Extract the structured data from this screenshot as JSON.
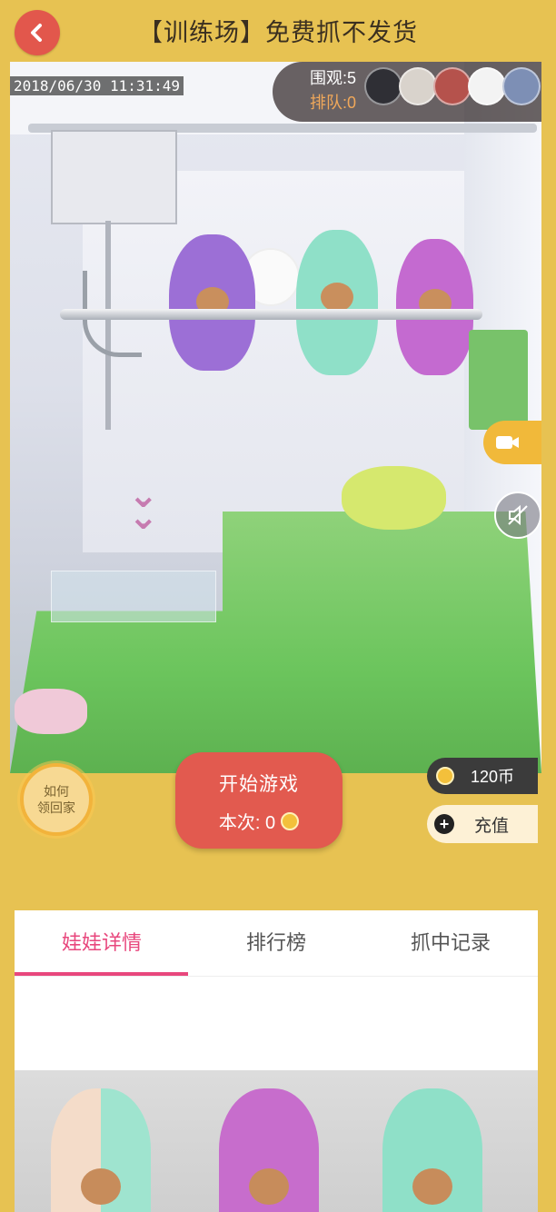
{
  "header": {
    "title": "【训练场】免费抓不发货"
  },
  "camera": {
    "timestamp": "2018/06/30 11:31:49",
    "watch_count": "围观:5",
    "queue_count": "排队:0"
  },
  "controls": {
    "howto_line1": "如何",
    "howto_line2": "领回家",
    "start_label": "开始游戏",
    "cost_label": "本次: 0",
    "balance": "120币",
    "recharge_label": "充值"
  },
  "tabs": [
    {
      "label": "娃娃详情",
      "active": true
    },
    {
      "label": "排行榜",
      "active": false
    },
    {
      "label": "抓中记录",
      "active": false
    }
  ],
  "colors": {
    "background": "#E7C252",
    "accent_red": "#E25A4F",
    "tab_active": "#E8477D",
    "queue_text": "#F0A85A"
  },
  "icons": {
    "back": "chevron-left-icon",
    "camera_switch": "camera-icon",
    "mute": "speaker-mute-icon",
    "coin": "coin-icon",
    "plus": "plus-icon"
  }
}
